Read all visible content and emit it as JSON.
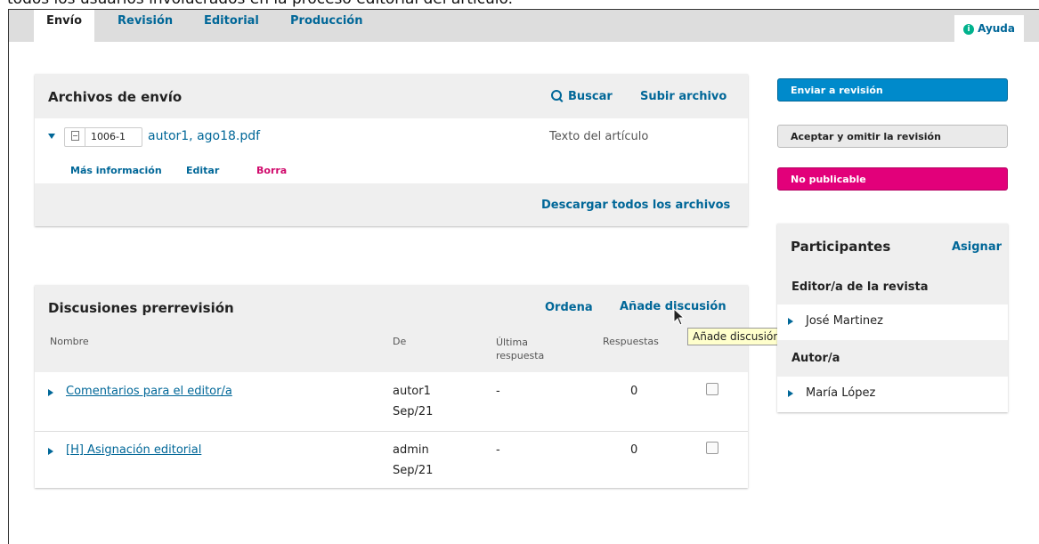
{
  "caption": "todos los usuarios involucrados en la proceso editorial del artículo.",
  "tabs": [
    {
      "label": "Envío"
    },
    {
      "label": "Revisión"
    },
    {
      "label": "Editorial"
    },
    {
      "label": "Producción"
    }
  ],
  "help": {
    "label": "Ayuda"
  },
  "files_panel": {
    "title": "Archivos de envío",
    "search_label": "Buscar",
    "upload_label": "Subir archivo",
    "file": {
      "id": "1006-1",
      "name": "autor1, ago18.pdf",
      "type": "Texto del artículo",
      "more_info": "Más información",
      "edit": "Editar",
      "delete": "Borra"
    },
    "download_all": "Descargar todos los archivos"
  },
  "discussions_panel": {
    "title": "Discusiones prerrevisión",
    "order_label": "Ordena",
    "add_label": "Añade discusión",
    "columns": [
      "Nombre",
      "De",
      "Última respuesta",
      "Respuestas"
    ],
    "rows": [
      {
        "name": "Comentarios para el editor/a",
        "from": "autor1",
        "date": "Sep/21",
        "last": "-",
        "replies": "0"
      },
      {
        "name": "[H] Asignación editorial",
        "from": "admin",
        "date": "Sep/21",
        "last": "-",
        "replies": "0"
      }
    ]
  },
  "tooltip": "Añade discusión",
  "actions": {
    "send_review": "Enviar a revisión",
    "accept_skip": "Aceptar y omitir la revisión",
    "decline": "No publicable"
  },
  "participants": {
    "title": "Participantes",
    "assign": "Asignar",
    "groups": [
      {
        "role": "Editor/a de la revista",
        "person": "José Martinez"
      },
      {
        "role": "Autor/a",
        "person": "María López"
      }
    ]
  }
}
